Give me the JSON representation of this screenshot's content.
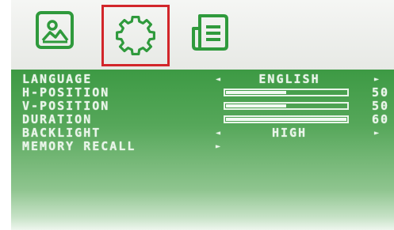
{
  "toolbar": {
    "tabs": [
      {
        "icon": "image-icon",
        "active": false
      },
      {
        "icon": "gear-icon",
        "active": true
      },
      {
        "icon": "document-icon",
        "active": false
      }
    ]
  },
  "menu": {
    "language": {
      "label": "LANGUAGE",
      "value": "ENGLISH"
    },
    "h_position": {
      "label": "H-POSITION",
      "value": "50",
      "level": 0.5
    },
    "v_position": {
      "label": "V-POSITION",
      "value": "50",
      "level": 0.5
    },
    "duration": {
      "label": "DURATION",
      "value": "60",
      "level": 1.0
    },
    "backlight": {
      "label": "BACKLIGHT",
      "value": "HIGH"
    },
    "memory_recall": {
      "label": "MEMORY RECALL"
    }
  },
  "colors": {
    "accent_green": "#2f9a3c",
    "menu_bg": "#3d9a44",
    "active_border": "#d2262a"
  }
}
